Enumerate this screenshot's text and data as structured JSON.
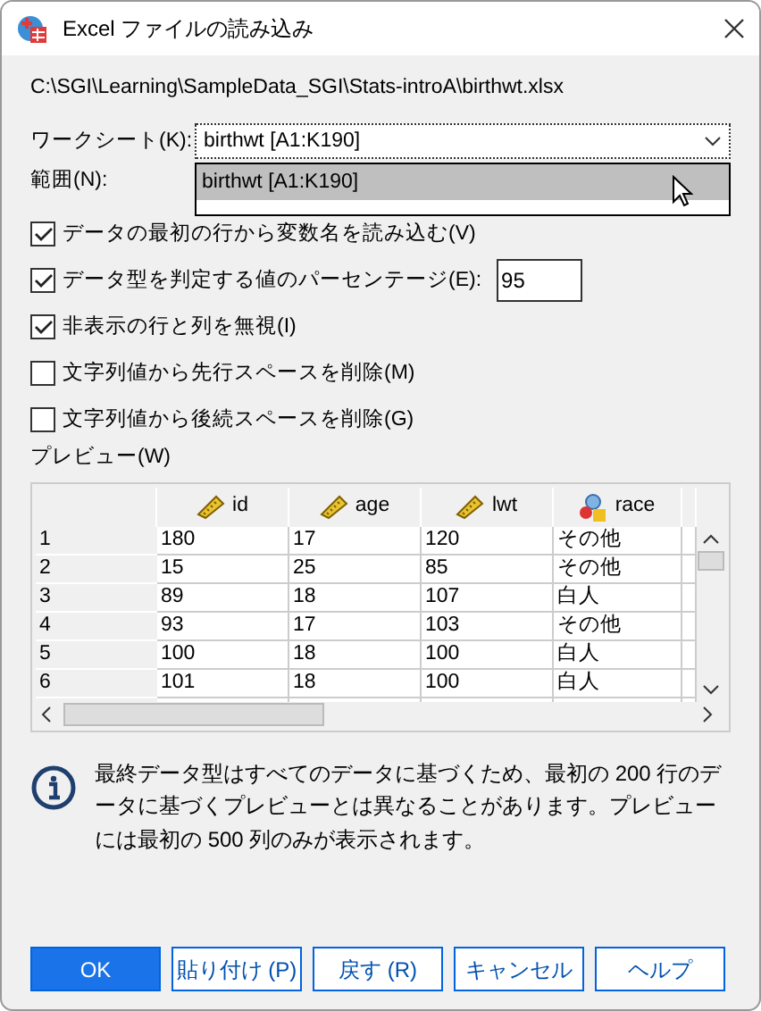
{
  "window": {
    "title": "Excel ファイルの読み込み"
  },
  "file_path": "C:\\SGI\\Learning\\SampleData_SGI\\Stats-introA\\birthwt.xlsx",
  "worksheet": {
    "label": "ワークシート(K):",
    "value": "birthwt [A1:K190]",
    "expanded": true,
    "options": [
      {
        "label": "birthwt [A1:K190]",
        "selected": true
      }
    ]
  },
  "range": {
    "label": "範囲(N):"
  },
  "options": [
    {
      "label": "データの最初の行から変数名を読み込む(V)",
      "checked": true
    },
    {
      "label": "データ型を判定する値のパーセンテージ(E):",
      "checked": true,
      "value": "95"
    },
    {
      "label": "非表示の行と列を無視(I)",
      "checked": true
    },
    {
      "label": "文字列値から先行スペースを削除(M)",
      "checked": false
    },
    {
      "label": "文字列値から後続スペースを削除(G)",
      "checked": false
    }
  ],
  "preview": {
    "label": "プレビュー(W)",
    "columns": [
      {
        "name": "id",
        "kind": "scale"
      },
      {
        "name": "age",
        "kind": "scale"
      },
      {
        "name": "lwt",
        "kind": "scale"
      },
      {
        "name": "race",
        "kind": "nominal"
      }
    ],
    "rows": [
      [
        "1",
        "180",
        "17",
        "120",
        "その他"
      ],
      [
        "2",
        "15",
        "25",
        "85",
        "その他"
      ],
      [
        "3",
        "89",
        "18",
        "107",
        "白人"
      ],
      [
        "4",
        "93",
        "17",
        "103",
        "その他"
      ],
      [
        "5",
        "100",
        "18",
        "100",
        "白人"
      ],
      [
        "6",
        "101",
        "18",
        "100",
        "白人"
      ]
    ]
  },
  "info": "最終データ型はすべてのデータに基づくため、最初の 200 行のデータに基づくプレビューとは異なることがあります。プレビューには最初の 500 列のみが表示されます。",
  "buttons": [
    {
      "label": "OK",
      "primary": true
    },
    {
      "label": "貼り付け (P)",
      "primary": false
    },
    {
      "label": "戻す (R)",
      "primary": false
    },
    {
      "label": "キャンセル",
      "primary": false
    },
    {
      "label": "ヘルプ",
      "primary": false
    }
  ]
}
